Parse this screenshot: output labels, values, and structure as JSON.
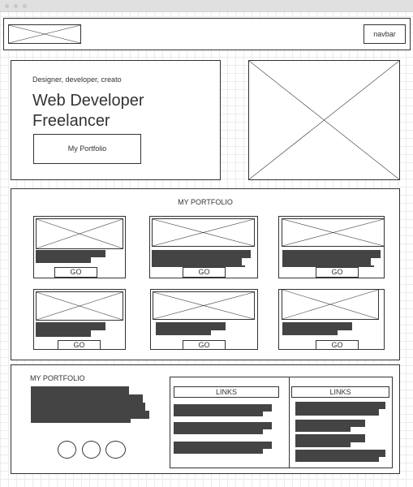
{
  "navbar": {
    "button_label": "navbar"
  },
  "hero": {
    "tagline": "Designer, developer, creato",
    "title_line1": "Web Developer",
    "title_line2": "Freelancer",
    "button_label": "My Portfolio"
  },
  "portfolio": {
    "heading": "MY PORTFOLIO",
    "card_button_label": "GO"
  },
  "footer": {
    "heading": "MY PORTFOLIO",
    "links_col1_title": "LINKS",
    "links_col2_title": "LINKS"
  },
  "colors": {
    "line": "#333333",
    "text_block": "#444444",
    "grid": "#ececec",
    "titlebar": "#e0e0e0"
  }
}
